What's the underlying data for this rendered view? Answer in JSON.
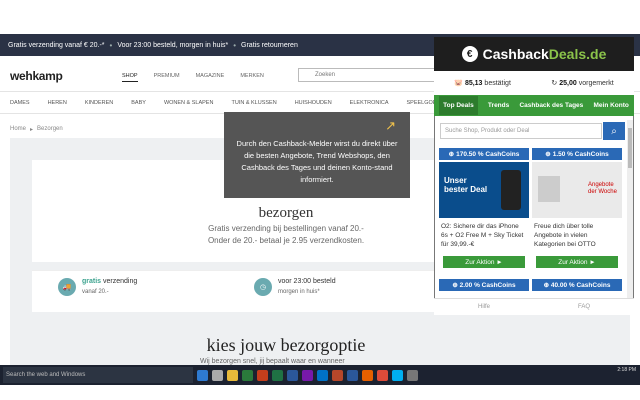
{
  "topbar": {
    "items": [
      "Gratis verzending vanaf € 20.-*",
      "Voor 23:00 besteld, morgen in huis*",
      "Gratis retourneren"
    ]
  },
  "header": {
    "logo": "wehkamp",
    "nav": [
      "SHOP",
      "PREMIUM",
      "MAGAZINE",
      "MERKEN"
    ],
    "search_placeholder": "Zoeken"
  },
  "categories": [
    "DAMES",
    "HEREN",
    "KINDEREN",
    "BABY",
    "WONEN & SLAPEN",
    "TUIN & KLUSSEN",
    "HUISHOUDEN",
    "ELEKTRONICA",
    "SPEELGOED & GAM"
  ],
  "breadcrumb": [
    "Home",
    "Bezorgen"
  ],
  "tooltip": {
    "text": "Durch den Cashback-Melder wirst du direkt über die besten Angebote, Trend Webshops, den Cashback des Tages und deinen Konto-stand informiert."
  },
  "main": {
    "title": "bezorgen",
    "sub1": "Gratis verzending bij bestellingen vanaf 20.-",
    "sub2": "Onder de 20.- betaal je 2.95 verzendkosten.",
    "features": [
      {
        "green": "gratis",
        "rest": " verzending",
        "small": "vanaf 20.-"
      },
      {
        "green": "",
        "rest": "voor 23:00 besteld",
        "small": "morgen in huis*"
      }
    ],
    "section_title": "kies jouw bezorgoptie",
    "section_sub": "Wij bezorgen snel, jij bepaalt waar en wanneer"
  },
  "taskbar": {
    "search": "Search the web and Windows",
    "clock": "2:18 PM"
  },
  "extension": {
    "brand_a": "Cashback",
    "brand_b": "Deals.de",
    "balance_confirmed": "85,13",
    "balance_confirmed_label": "bestätigt",
    "balance_pending": "25,00",
    "balance_pending_label": "vorgemerkt",
    "tabs": [
      "Top Deals",
      "Trends",
      "Cashback des Tages",
      "Mein Konto"
    ],
    "search_placeholder": "Suche Shop, Produkt oder Deal",
    "deals": [
      {
        "cashcoins": "170.50 % CashCoins",
        "text": "O2: Sichere dir das iPhone 6s + O2 Free M + Sky Ticket für 39,99.-€",
        "button": "Zur Aktion ►",
        "img_text": "Unser bester Deal"
      },
      {
        "cashcoins": "1.50 % CashCoins",
        "text": "Freue dich über tolle Angebote in vielen Kategorien bei OTTO",
        "button": "Zur Aktion ►",
        "img_text": "Angebote der Woche"
      }
    ],
    "more_deals": [
      "2.00 % CashCoins",
      "40.00 % CashCoins"
    ],
    "footer": [
      "Hilfe",
      "FAQ"
    ]
  },
  "colors": {
    "topbar": "#2a3245",
    "ext_green": "#3a9a3a",
    "ext_blue": "#2a69b6",
    "gratis_green": "#3da38f"
  }
}
